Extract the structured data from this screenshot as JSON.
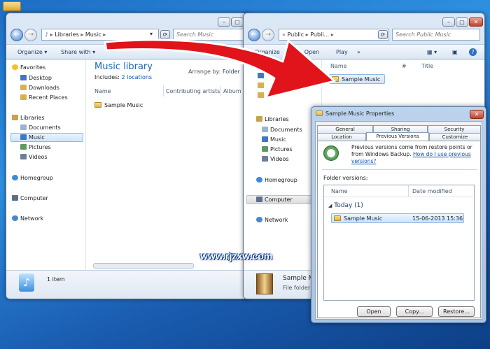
{
  "left_window": {
    "address": [
      "Libraries",
      "Music"
    ],
    "search_placeholder": "Search Music",
    "toolbar": {
      "organize": "Organize",
      "share_with": "Share with"
    },
    "nav": {
      "favorites": "Favorites",
      "favorites_items": [
        "Desktop",
        "Downloads",
        "Recent Places"
      ],
      "libraries": "Libraries",
      "libraries_items": [
        "Documents",
        "Music",
        "Pictures",
        "Videos"
      ],
      "homegroup": "Homegroup",
      "computer": "Computer",
      "network": "Network"
    },
    "library_title": "Music library",
    "includes_label": "Includes:",
    "includes_link": "2 locations",
    "arrange_label": "Arrange by:",
    "arrange_value": "Folder",
    "columns": [
      "Name",
      "Contributing artists",
      "Album"
    ],
    "items": [
      "Sample Music"
    ],
    "status_count": "1 item"
  },
  "right_window": {
    "address": [
      "Public",
      "Publi..."
    ],
    "search_placeholder": "Search Public Music",
    "toolbar": {
      "organize": "Organize",
      "open": "Open",
      "play": "Play",
      "more": "»"
    },
    "nav": {
      "libraries": "Libraries",
      "libraries_items": [
        "Documents",
        "Music",
        "Pictures",
        "Videos"
      ],
      "homegroup": "Homegroup",
      "computer": "Computer",
      "network": "Network"
    },
    "columns": [
      "Name",
      "#",
      "Title"
    ],
    "items": [
      "Sample Music"
    ],
    "details_name": "Sample Mu",
    "details_type": "File folder"
  },
  "dialog": {
    "title": "Sample Music Properties",
    "tabs_row1": [
      "General",
      "Sharing",
      "Security"
    ],
    "tabs_row2": [
      "Location",
      "Previous Versions",
      "Customize"
    ],
    "active_tab": "Previous Versions",
    "description": "Previous versions come from restore points or from Windows Backup.",
    "help_link": "How do I use previous versions?",
    "folder_versions_label": "Folder versions:",
    "columns": [
      "Name",
      "Date modified"
    ],
    "group": "Today (1)",
    "versions": [
      {
        "name": "Sample Music",
        "date": "15-06-2013 15:36"
      }
    ],
    "buttons": [
      "Open",
      "Copy...",
      "Restore..."
    ]
  },
  "watermark": "www.rjzxw.com",
  "colors": {
    "arrow": "#e0141a",
    "link": "#0b4fb3",
    "title_blue": "#1e64b4"
  }
}
